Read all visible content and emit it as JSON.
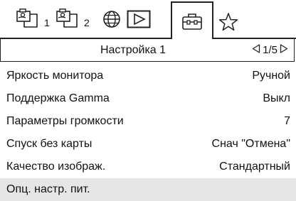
{
  "tabs": [
    {
      "name": "tab-playback-1",
      "icon": "playback-folder-icon",
      "number": "1"
    },
    {
      "name": "tab-playback-2",
      "icon": "playback-folder-icon",
      "number": "2"
    },
    {
      "name": "tab-network",
      "icon": "globe-icon"
    },
    {
      "name": "tab-playback",
      "icon": "play-icon"
    },
    {
      "name": "tab-setup",
      "icon": "toolbox-icon",
      "active": true
    },
    {
      "name": "tab-my-menu",
      "icon": "star-icon"
    }
  ],
  "header": {
    "title": "Настройка 1",
    "page": "1/5"
  },
  "items": [
    {
      "label": "Яркость монитора",
      "value": "Ручной"
    },
    {
      "label": "Поддержка Gamma",
      "value": "Выкл"
    },
    {
      "label": "Параметры громкости",
      "value": "7"
    },
    {
      "label": "Спуск без карты",
      "value": "Снач \"Отмена\""
    },
    {
      "label": "Качество изображ.",
      "value": "Стандартный"
    },
    {
      "label": "Опц. настр. пит.",
      "value": "",
      "selected": true
    }
  ]
}
